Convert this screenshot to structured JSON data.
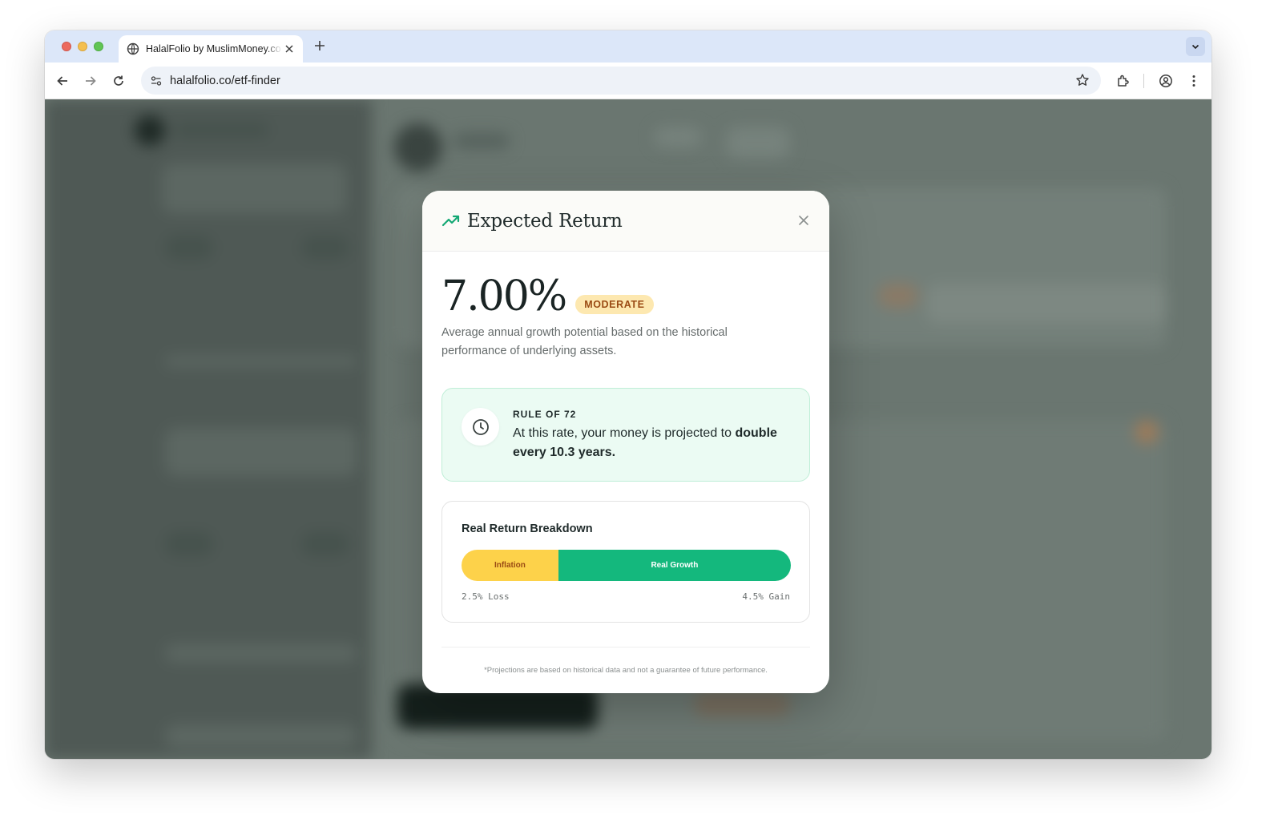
{
  "browser": {
    "tab_title": "HalalFolio by MuslimMoney.co",
    "url": "halalfolio.co/etf-finder",
    "icons": [
      "back-arrow-icon",
      "forward-arrow-icon",
      "reload-icon",
      "site-info-icon",
      "star-icon",
      "extensions-icon",
      "profile-icon",
      "more-menu-icon"
    ]
  },
  "modal": {
    "title": "Expected Return",
    "rate": "7.00%",
    "risk_label": "MODERATE",
    "description": "Average annual growth potential based on the historical performance of underlying assets.",
    "rule": {
      "label": "RULE OF 72",
      "text_prefix": "At this rate, your money is projected to ",
      "text_bold": "double every 10.3 years."
    },
    "breakdown": {
      "title": "Real Return Breakdown",
      "inflation_label": "Inflation",
      "growth_label": "Real Growth",
      "inflation_pct": 2.5,
      "growth_pct": 4.5,
      "left_label": "2.5% Loss",
      "right_label": "4.5% Gain"
    },
    "disclaimer": "*Projections are based on historical data and not a guarantee of future performance."
  },
  "colors": {
    "accent_green": "#14b87d",
    "inflation_yellow": "#fdd24a",
    "badge_bg": "#fde8b0",
    "badge_text": "#9a4b14",
    "overlay": "#6a7670"
  }
}
